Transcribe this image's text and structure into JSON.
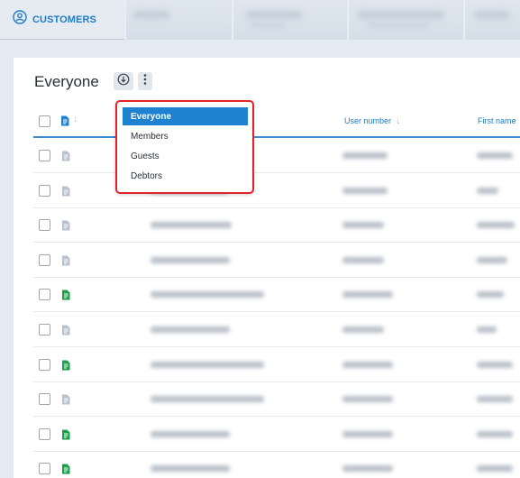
{
  "tabs": {
    "active_label": "CUSTOMERS"
  },
  "panel": {
    "title": "Everyone"
  },
  "table": {
    "headers": {
      "user_number": "User number",
      "first_name": "First name"
    }
  },
  "dropdown": {
    "options": [
      "Everyone",
      "Members",
      "Guests",
      "Debtors"
    ],
    "selected": "Everyone"
  },
  "colors": {
    "accent": "#1d7cc8",
    "selection": "#1f82d1",
    "highlight_border": "#e0242b",
    "doc_icon_green": "#1e9e4a",
    "doc_icon_grey": "#b7c2cd"
  },
  "rows": [
    {
      "doc_icon": "grey-doc-icon"
    },
    {
      "doc_icon": "grey-doc-icon"
    },
    {
      "doc_icon": "grey-doc-icon"
    },
    {
      "doc_icon": "grey-doc-icon"
    },
    {
      "doc_icon": "green-doc-icon"
    },
    {
      "doc_icon": "grey-doc-icon"
    },
    {
      "doc_icon": "green-doc-icon"
    },
    {
      "doc_icon": "grey-doc-icon"
    },
    {
      "doc_icon": "green-doc-icon"
    },
    {
      "doc_icon": "green-doc-icon"
    }
  ]
}
